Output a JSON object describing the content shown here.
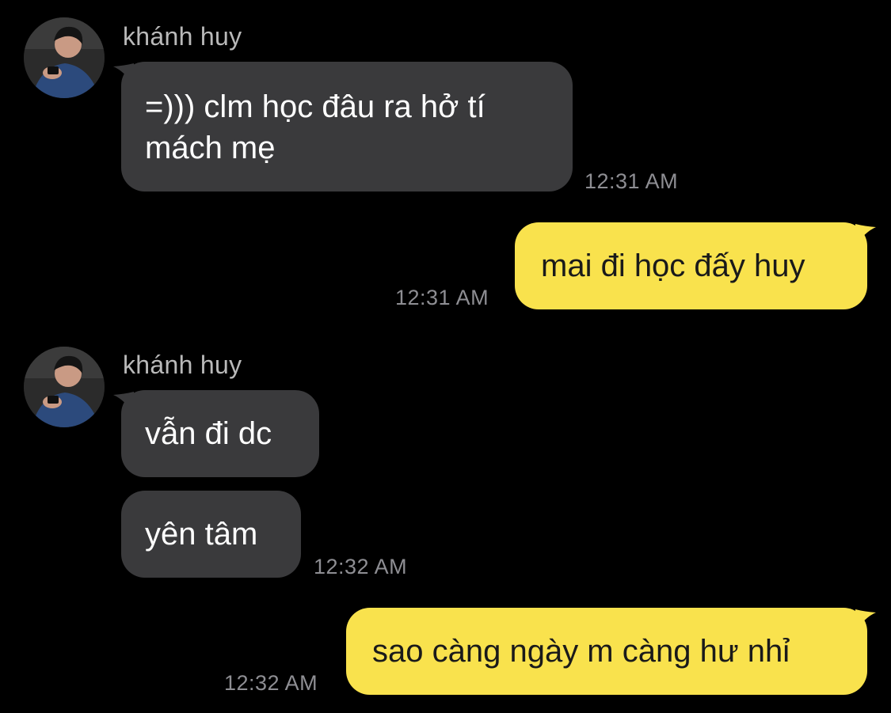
{
  "theme": {
    "background": "#000000",
    "incoming_bubble": "#3a3a3c",
    "outgoing_bubble": "#f9e24d",
    "outgoing_text": "#1a1a1a",
    "sender_name_color": "#b9b9b9",
    "timestamp_color": "#8e8e93"
  },
  "groups": [
    {
      "sender": "khánh huy",
      "avatar": "profile-photo",
      "messages": [
        "=))) clm học đâu ra hở tí mách mẹ"
      ],
      "time": "12:31 AM"
    },
    {
      "sender": "me",
      "messages": [
        "mai đi học đấy huy"
      ],
      "time": "12:31 AM"
    },
    {
      "sender": "khánh huy",
      "avatar": "profile-photo",
      "messages": [
        "vẫn đi dc",
        "yên tâm"
      ],
      "time": "12:32 AM"
    },
    {
      "sender": "me",
      "messages": [
        "sao càng ngày m càng hư nhỉ"
      ],
      "time": "12:32 AM"
    }
  ],
  "bubble_lines": {
    "g0_line1": "=))) clm học đâu ra hở tí",
    "g0_line2": "mách mẹ"
  }
}
